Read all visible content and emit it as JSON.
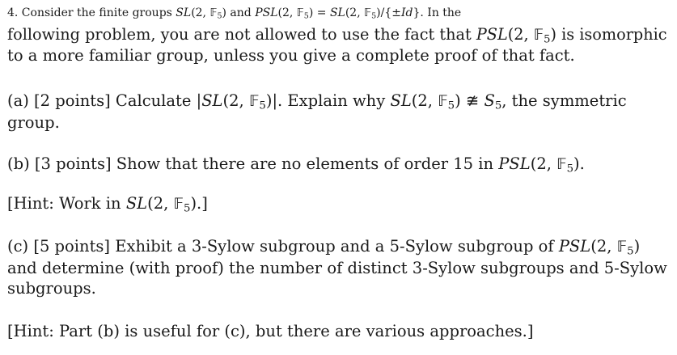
{
  "problem": {
    "intro": {
      "line1_a": "4. Consider the finite groups ",
      "sl": "SL",
      "args": "(2, ",
      "field": "𝔽",
      "sub5": "5",
      "close": ")",
      "and": " and ",
      "psl": "PSL",
      "eq": " = ",
      "quot": "/{±",
      "id": "Id",
      "brace": "}",
      "period_in_the": ". In the",
      "line2_a": "following problem, you are not allowed to use the fact that ",
      "line2_b": " is isomorphic",
      "line3": "to a more familiar group, unless you give a complete proof of that fact."
    },
    "part_a": {
      "label": "(a) [2 points] Calculate |",
      "abs_close": ")|. Explain why ",
      "ncong": " ≇ ",
      "s": "S",
      "comma_sym": ", the symmetric",
      "line2": "group."
    },
    "part_b": {
      "label": "(b) [3 points] Show that there are no elements of order 15 in ",
      "end": ")."
    },
    "hint_b": {
      "text": "[Hint: Work in ",
      "end": ").]"
    },
    "part_c": {
      "line1_a": "(c) [5 points] Exhibit a 3-Sylow subgroup and a 5-Sylow subgroup of ",
      "line2": "and determine (with proof) the number of distinct 3-Sylow subgroups and 5-Sylow",
      "line3": "subgroups."
    },
    "hint_c": {
      "text": "[Hint: Part (b) is useful for (c), but there are various approaches.]"
    }
  }
}
